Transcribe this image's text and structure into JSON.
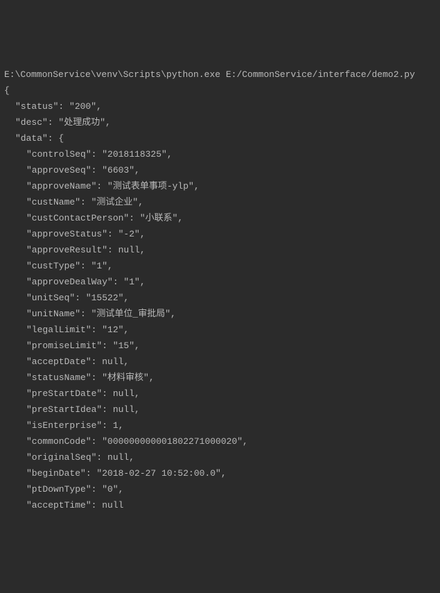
{
  "console": {
    "command": "E:\\CommonService\\venv\\Scripts\\python.exe E:/CommonService/interface/demo2.py",
    "open_brace": "{",
    "lines": [
      {
        "indent": 1,
        "text": "\"status\": \"200\","
      },
      {
        "indent": 1,
        "text": "\"desc\": \"处理成功\","
      },
      {
        "indent": 1,
        "text": "\"data\": {"
      },
      {
        "indent": 2,
        "text": "\"controlSeq\": \"2018118325\","
      },
      {
        "indent": 2,
        "text": "\"approveSeq\": \"6603\","
      },
      {
        "indent": 2,
        "text": "\"approveName\": \"测试表单事项-ylp\","
      },
      {
        "indent": 2,
        "text": "\"custName\": \"测试企业\","
      },
      {
        "indent": 2,
        "text": "\"custContactPerson\": \"小联系\","
      },
      {
        "indent": 2,
        "text": "\"approveStatus\": \"-2\","
      },
      {
        "indent": 2,
        "text": "\"approveResult\": null,"
      },
      {
        "indent": 2,
        "text": "\"custType\": \"1\","
      },
      {
        "indent": 2,
        "text": "\"approveDealWay\": \"1\","
      },
      {
        "indent": 2,
        "text": "\"unitSeq\": \"15522\","
      },
      {
        "indent": 2,
        "text": "\"unitName\": \"测试单位_审批局\","
      },
      {
        "indent": 2,
        "text": "\"legalLimit\": \"12\","
      },
      {
        "indent": 2,
        "text": "\"promiseLimit\": \"15\","
      },
      {
        "indent": 2,
        "text": "\"acceptDate\": null,"
      },
      {
        "indent": 2,
        "text": "\"statusName\": \"材料审核\","
      },
      {
        "indent": 2,
        "text": "\"preStartDate\": null,"
      },
      {
        "indent": 2,
        "text": "\"preStartIdea\": null,"
      },
      {
        "indent": 2,
        "text": "\"isEnterprise\": 1,"
      },
      {
        "indent": 2,
        "text": "\"commonCode\": \"000000000001802271000020\","
      },
      {
        "indent": 2,
        "text": "\"originalSeq\": null,"
      },
      {
        "indent": 2,
        "text": "\"beginDate\": \"2018-02-27 10:52:00.0\","
      },
      {
        "indent": 2,
        "text": "\"ptDownType\": \"0\","
      },
      {
        "indent": 2,
        "text": "\"acceptTime\": null"
      }
    ]
  }
}
